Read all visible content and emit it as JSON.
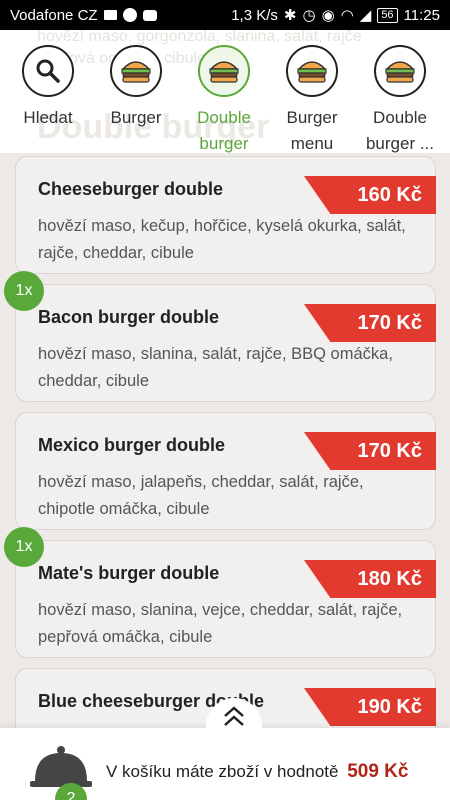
{
  "status": {
    "carrier": "Vodafone CZ",
    "speed": "1,3 K/s",
    "battery": "56",
    "time": "11:25"
  },
  "ghost": {
    "line1": "hovězí maso, gorgonzola, slanina, salát, rajče",
    "line2": "pepřová omáčka, cibule",
    "heading": "Double burger"
  },
  "categories": [
    {
      "label": "Hledat",
      "icon": "search-icon"
    },
    {
      "label": "Burger",
      "icon": "burger-icon"
    },
    {
      "label": "Double\nburger",
      "icon": "burger-icon",
      "active": true
    },
    {
      "label": "Burger\nmenu",
      "icon": "burger-icon"
    },
    {
      "label": "Double\nburger ...",
      "icon": "burger-icon"
    }
  ],
  "products": [
    {
      "name": "Cheeseburger double",
      "price": "160 Kč",
      "desc": "hovězí maso, kečup, hořčice, kyselá okurka, salát, rajče, cheddar, cibule",
      "qty": ""
    },
    {
      "name": "Bacon burger double",
      "price": "170 Kč",
      "desc": "hovězí maso, slanina, salát, rajče, BBQ omáčka, cheddar, cibule",
      "qty": "1x"
    },
    {
      "name": "Mexico burger double",
      "price": "170 Kč",
      "desc": "hovězí maso, jalapeňs, cheddar, salát, rajče, chipotle omáčka, cibule",
      "qty": ""
    },
    {
      "name": "Mate's burger double",
      "price": "180 Kč",
      "desc": "hovězí maso, slanina, vejce, cheddar, salát, rajče, pepřová omáčka, cibule",
      "qty": "1x"
    },
    {
      "name": "Blue cheeseburger double",
      "price": "190 Kč",
      "desc": "",
      "qty": ""
    }
  ],
  "cart": {
    "text": "V košíku máte zboží v hodnotě",
    "total": "509 Kč",
    "count": "2"
  },
  "colors": {
    "accent": "#5aa83a",
    "price": "#e23a2e",
    "total": "#b22418"
  }
}
